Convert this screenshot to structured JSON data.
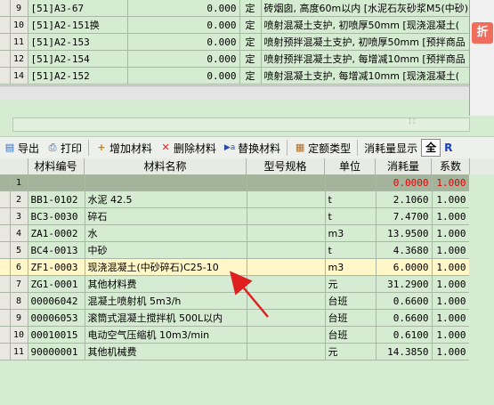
{
  "top_rows": [
    {
      "num": "9",
      "code": "[51]A3-67",
      "qty": "0.000",
      "type": "定",
      "name": "砖烟囱, 高度60m以内 [水泥石灰砂浆M5(中砂)"
    },
    {
      "num": "10",
      "code": "[51]A2-151换",
      "qty": "0.000",
      "type": "定",
      "name": "喷射混凝土支护, 初喷厚50mm [现浇混凝土("
    },
    {
      "num": "11",
      "code": "[51]A2-153",
      "qty": "0.000",
      "type": "定",
      "name": "喷射预拌混凝土支护, 初喷厚50mm [预拌商品"
    },
    {
      "num": "12",
      "code": "[51]A2-154",
      "qty": "0.000",
      "type": "定",
      "name": "喷射预拌混凝土支护, 每增减10mm [预拌商品"
    },
    {
      "num": "14",
      "code": "[51]A2-152",
      "qty": "0.000",
      "type": "定",
      "name": "喷射混凝土支护, 每增减10mm [现浇混凝土("
    }
  ],
  "right_icon_label": "折",
  "toolbar": {
    "export": "导出",
    "print": "打印",
    "add_material": "增加材料",
    "delete_material": "删除材料",
    "replace_material": "替换材料",
    "quota_type": "定额类型",
    "consumption_display": "消耗量显示",
    "all": "全",
    "r": "R"
  },
  "materials_header": {
    "code": "材料编号",
    "name": "材料名称",
    "spec": "型号规格",
    "unit": "单位",
    "consumption": "消耗量",
    "coef": "系数"
  },
  "materials": [
    {
      "num": "1",
      "code": "",
      "name": "",
      "spec": "",
      "unit": "",
      "consumption": "0.0000",
      "coef": "1.000"
    },
    {
      "num": "2",
      "code": "BB1-0102",
      "name": "水泥 42.5",
      "spec": "",
      "unit": "t",
      "consumption": "2.1060",
      "coef": "1.000"
    },
    {
      "num": "3",
      "code": "BC3-0030",
      "name": "碎石",
      "spec": "",
      "unit": "t",
      "consumption": "7.4700",
      "coef": "1.000"
    },
    {
      "num": "4",
      "code": "ZA1-0002",
      "name": "水",
      "spec": "",
      "unit": "m3",
      "consumption": "13.9500",
      "coef": "1.000"
    },
    {
      "num": "5",
      "code": "BC4-0013",
      "name": "中砂",
      "spec": "",
      "unit": "t",
      "consumption": "4.3680",
      "coef": "1.000"
    },
    {
      "num": "6",
      "code": "ZF1-0003",
      "name": "现浇混凝土(中砂碎石)C25-10",
      "spec": "",
      "unit": "m3",
      "consumption": "6.0000",
      "coef": "1.000"
    },
    {
      "num": "7",
      "code": "ZG1-0001",
      "name": "其他材料费",
      "spec": "",
      "unit": "元",
      "consumption": "31.2900",
      "coef": "1.000"
    },
    {
      "num": "8",
      "code": "00006042",
      "name": "混凝土喷射机 5m3/h",
      "spec": "",
      "unit": "台班",
      "consumption": "0.6600",
      "coef": "1.000"
    },
    {
      "num": "9",
      "code": "00006053",
      "name": "滚筒式混凝土搅拌机 500L以内",
      "spec": "",
      "unit": "台班",
      "consumption": "0.6600",
      "coef": "1.000"
    },
    {
      "num": "10",
      "code": "00010015",
      "name": "电动空气压缩机 10m3/min",
      "spec": "",
      "unit": "台班",
      "consumption": "0.6100",
      "coef": "1.000"
    },
    {
      "num": "11",
      "code": "90000001",
      "name": "其他机械费",
      "spec": "",
      "unit": "元",
      "consumption": "14.3850",
      "coef": "1.000"
    }
  ],
  "colors": {
    "grid_bg": "#d6ecd2",
    "highlight_row": "#fff7c8",
    "arrow": "#e02020",
    "red_text": "#e00000"
  }
}
